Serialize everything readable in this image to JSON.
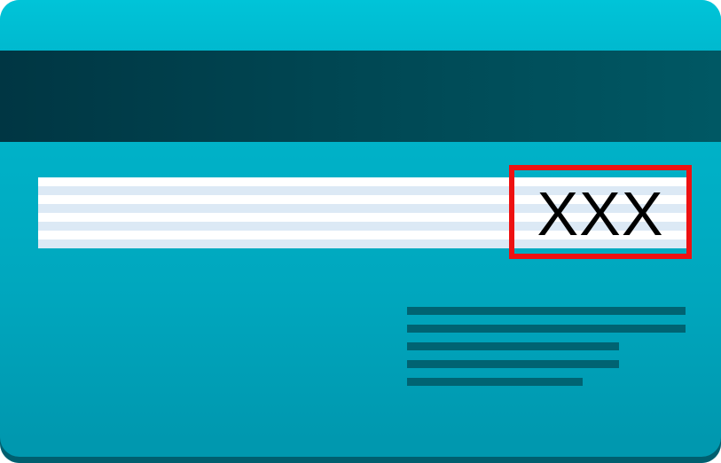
{
  "card": {
    "cvv_placeholder": "XXX",
    "info_lines": 5
  },
  "colors": {
    "card_top": "#00bfd4",
    "card_bottom": "#0098af",
    "magnetic_stripe": "#003643",
    "signature_strip_light": "#dce9f5",
    "cvv_highlight": "#ee1111",
    "info_lines": "#006372"
  }
}
